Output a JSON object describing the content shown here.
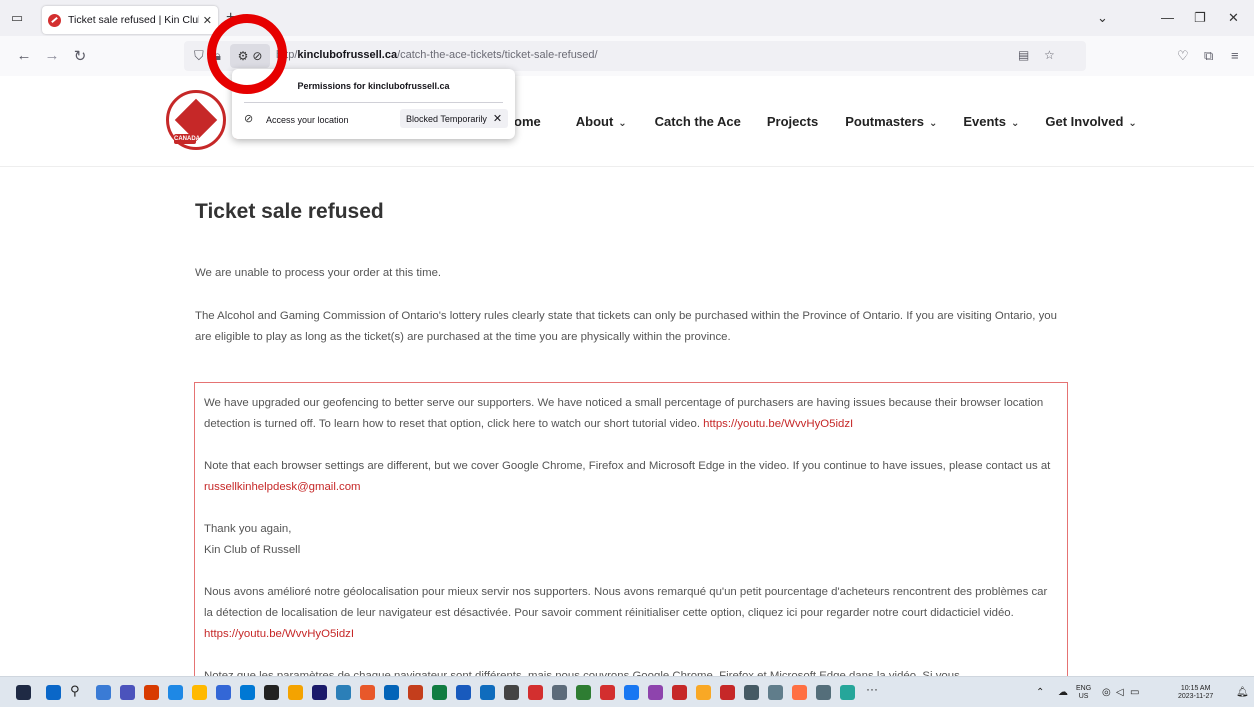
{
  "browser": {
    "tab_title": "Ticket sale refused | Kin Club of R",
    "url_prefix": "http",
    "url_host": "kinclubofrussell.ca",
    "url_path": "/catch-the-ace-tickets/ticket-sale-refused/"
  },
  "permissions_popup": {
    "title": "Permissions for kinclubofrussell.ca",
    "permission_label": "Access your location",
    "status": "Blocked Temporarily"
  },
  "site": {
    "badge": "CANADA",
    "nav": [
      {
        "label": "ome",
        "has_dropdown": false
      },
      {
        "label": "About",
        "has_dropdown": true
      },
      {
        "label": "Catch the Ace",
        "has_dropdown": false
      },
      {
        "label": "Projects",
        "has_dropdown": false
      },
      {
        "label": "Poutmasters",
        "has_dropdown": true
      },
      {
        "label": "Events",
        "has_dropdown": true
      },
      {
        "label": "Get Involved",
        "has_dropdown": true
      }
    ]
  },
  "content": {
    "title": "Ticket sale refused",
    "p1": "We are unable to process your order at this time.",
    "p2": "The Alcohol and Gaming Commission of Ontario's lottery rules clearly state that tickets can only be purchased within the Province of Ontario. If you are visiting Ontario, you are eligible to play as long as the ticket(s) are purchased at the time you are physically within the province.",
    "notice": {
      "en_1": "We have upgraded our geofencing to better serve our supporters. We have noticed a small percentage of purchasers are having issues because their browser location detection is turned off. To learn how to reset that option, click here to watch our short tutorial video. ",
      "video_link": "https://youtu.be/WvvHyO5idzI",
      "en_2": "Note that each browser settings are different, but we cover Google Chrome, Firefox and Microsoft Edge in the video. If you continue to have issues, please contact us at ",
      "email_link": "russellkinhelpdesk@gmail.com",
      "thanks_line1": "Thank you again,",
      "thanks_line2": "Kin Club of Russell",
      "fr_1": "Nous avons amélioré notre géolocalisation pour mieux servir nos supporters. Nous avons remarqué qu'un petit pourcentage d'acheteurs rencontrent des problèmes car la détection de localisation de leur navigateur est désactivée. Pour savoir comment réinitialiser cette option, cliquez ici pour regarder notre court didacticiel vidéo. ",
      "video_link_fr": "https://youtu.be/WvvHyO5idzI",
      "fr_2": "Notez que les paramètres de chaque navigateur sont différents, mais nous couvrons Google Chrome, Firefox et Microsoft Edge dans la vidéo. Si vous"
    }
  },
  "taskbar": {
    "lang": "ENG",
    "region": "US",
    "time": "10:15 AM",
    "date": "2023-11-27"
  },
  "colors": {
    "accent_red": "#c62828",
    "annotation_red": "#e60000",
    "notice_border": "#e57373",
    "text_gray": "#555555"
  }
}
